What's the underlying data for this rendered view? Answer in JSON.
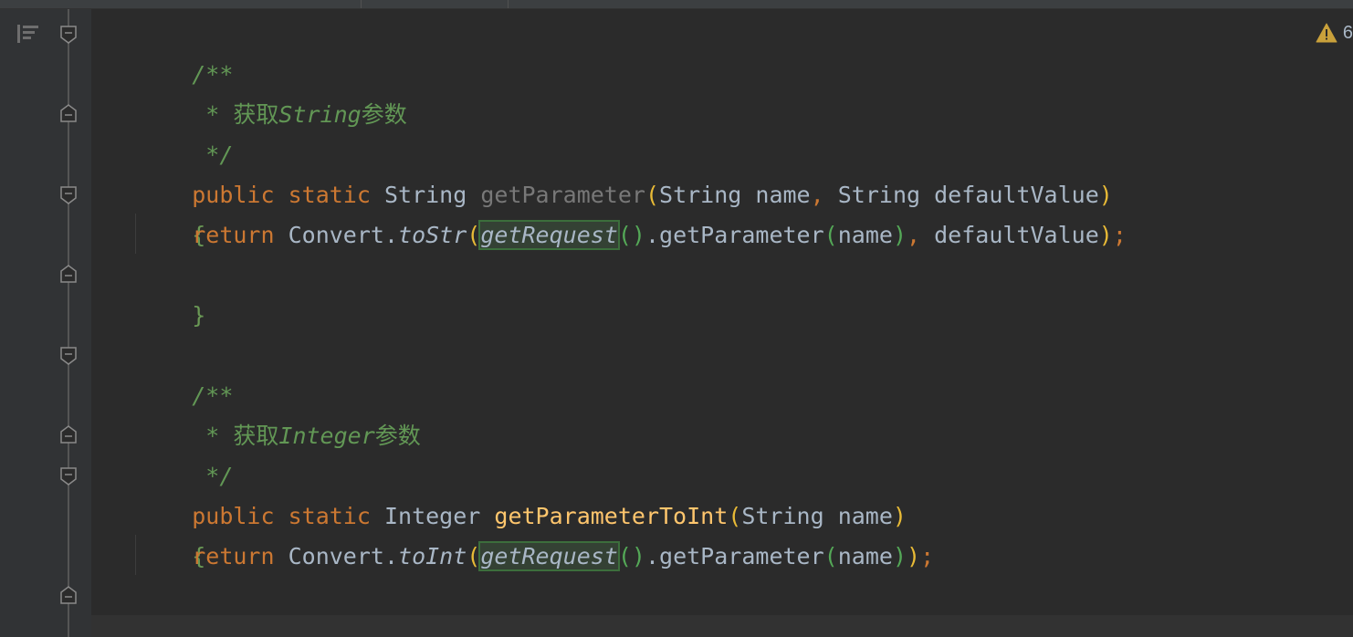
{
  "editor": {
    "inspection_count": "6",
    "block1": {
      "doc_open": "/**",
      "doc_star": " * ",
      "doc_cn_1": "获取",
      "doc_type": "String",
      "doc_cn_2": "参数",
      "doc_close": " */",
      "kw_public": "public",
      "kw_static": "static",
      "return_type": "String",
      "method_name": "getParameter",
      "param_type_1": "String",
      "param_name_1": "name",
      "comma": ",",
      "param_type_2": "String",
      "param_name_2": "defaultValue",
      "open_brace": "{",
      "kw_return": "return",
      "class_ref": "Convert",
      "static_call": "toStr",
      "request_call": "getRequest",
      "get_param": "getParameter",
      "arg_name": "name",
      "arg_default": "defaultValue",
      "close_brace": "}"
    },
    "block2": {
      "doc_open": "/**",
      "doc_star": " * ",
      "doc_cn_1": "获取",
      "doc_type": "Integer",
      "doc_cn_2": "参数",
      "doc_close": " */",
      "kw_public": "public",
      "kw_static": "static",
      "return_type": "Integer",
      "method_name": "getParameterToInt",
      "param_type_1": "String",
      "param_name_1": "name",
      "open_brace": "{",
      "kw_return": "return",
      "class_ref": "Convert",
      "static_call": "toInt",
      "request_call": "getRequest",
      "get_param": "getParameter",
      "arg_name": "name",
      "close_brace": "}"
    }
  }
}
